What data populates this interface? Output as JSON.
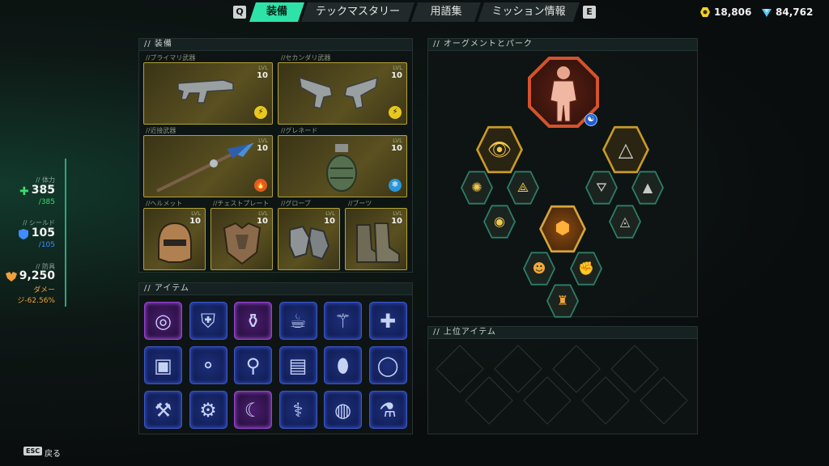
{
  "nav": {
    "left_key": "Q",
    "right_key": "E",
    "tabs": [
      {
        "label": "装備",
        "active": true
      },
      {
        "label": "テックマスタリー",
        "active": false
      },
      {
        "label": "用語集",
        "active": false
      },
      {
        "label": "ミッション情報",
        "active": false
      }
    ]
  },
  "currency": {
    "gold": "18,806",
    "gems": "84,762"
  },
  "stats": {
    "health_label": "// 体力",
    "health": "385",
    "health_max": "/385",
    "shield_label": "// シールド",
    "shield": "105",
    "shield_max": "/105",
    "defense_label": "// 防具",
    "defense": "9,250",
    "defense_sub1": "ダメー",
    "defense_sub2": "ジ-62.56%"
  },
  "equipment": {
    "title": "// 装備",
    "lvl_label": "LVL",
    "slots": [
      {
        "label": "//プライマリ武器",
        "level": "10",
        "element": "lightning-icon"
      },
      {
        "label": "//セカンダリ武器",
        "level": "10",
        "element": "lightning-icon"
      },
      {
        "label": "//近接武器",
        "level": "10",
        "element": "fire-icon"
      },
      {
        "label": "//グレネード",
        "level": "10",
        "element": "frost-icon"
      },
      {
        "label": "//ヘルメット",
        "level": "10"
      },
      {
        "label": "//チェストプレート",
        "level": "10"
      },
      {
        "label": "//グローブ",
        "level": "10"
      },
      {
        "label": "//ブーツ",
        "level": "10"
      }
    ]
  },
  "items": {
    "title": "// アイテム",
    "grid": [
      {
        "icon": "bracelet-icon",
        "rarity": "purple"
      },
      {
        "icon": "armor-plate-icon",
        "rarity": "blue"
      },
      {
        "icon": "canister-icon",
        "rarity": "purple"
      },
      {
        "icon": "coffee-cup-icon",
        "rarity": "blue"
      },
      {
        "icon": "wand-icon",
        "rarity": "blue"
      },
      {
        "icon": "medkit-bag-icon",
        "rarity": "blue"
      },
      {
        "icon": "chest-icon",
        "rarity": "blue"
      },
      {
        "icon": "brass-knuckles-icon",
        "rarity": "blue"
      },
      {
        "icon": "spark-plug-icon",
        "rarity": "blue"
      },
      {
        "icon": "battery-icon",
        "rarity": "blue"
      },
      {
        "icon": "jar-icon",
        "rarity": "blue"
      },
      {
        "icon": "ring-band-icon",
        "rarity": "blue"
      },
      {
        "icon": "hammer-icon",
        "rarity": "blue"
      },
      {
        "icon": "device-icon",
        "rarity": "blue"
      },
      {
        "icon": "magazine-icon",
        "rarity": "purple"
      },
      {
        "icon": "arm-icon",
        "rarity": "blue"
      },
      {
        "icon": "disc-icon",
        "rarity": "blue"
      },
      {
        "icon": "bottle-icon",
        "rarity": "blue"
      }
    ]
  },
  "augments": {
    "title": "// オーグメントとパーク"
  },
  "top_items": {
    "title": "// 上位アイテム"
  },
  "footer": {
    "esc_key": "ESC",
    "back_label": "戻る"
  },
  "colors": {
    "accent": "#2fe3a8",
    "health": "#3ddc6f",
    "shield": "#3f8cff",
    "defense": "#f0a03a",
    "gold_slot": "#b2a235"
  }
}
